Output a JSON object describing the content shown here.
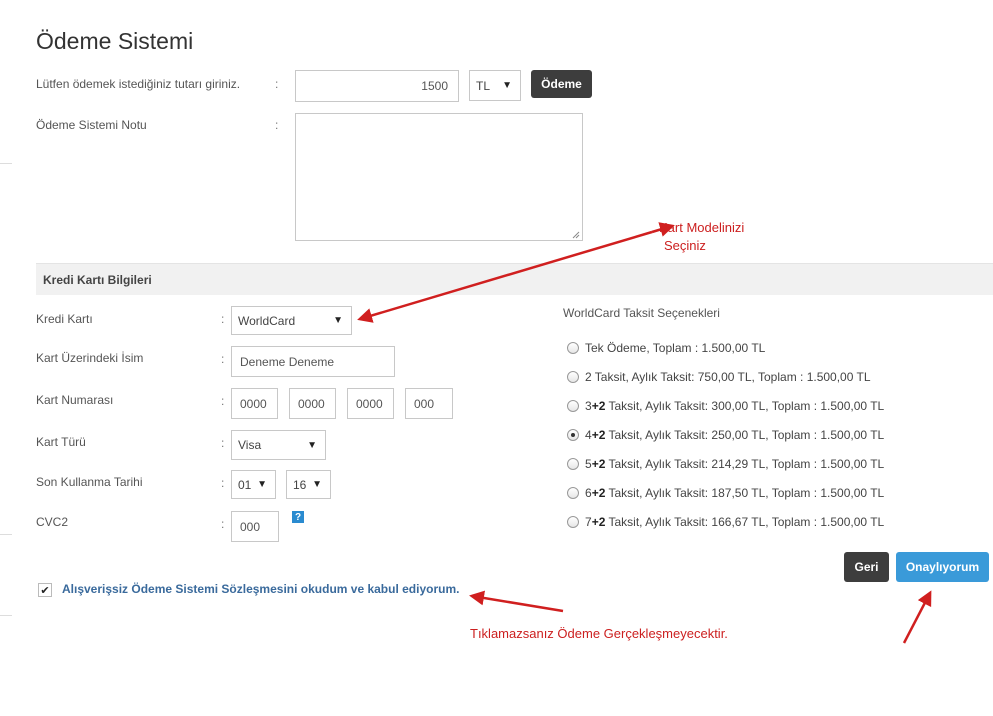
{
  "page": {
    "title": "Ödeme Sistemi"
  },
  "amount": {
    "label": "Lütfen ödemek istediğiniz tutarı giriniz.",
    "colon": ":",
    "value": "1500",
    "currency": "TL",
    "pay_button": "Ödeme"
  },
  "note": {
    "label": "Ödeme Sistemi Notu",
    "colon": ":",
    "value": ""
  },
  "card_section": {
    "title": "Kredi Kartı Bilgileri",
    "card_label": "Kredi Kartı",
    "card_value": "WorldCard",
    "name_label": "Kart Üzerindeki İsim",
    "name_value": "Deneme Deneme",
    "number_label": "Kart Numarası",
    "number_parts": [
      "0000",
      "0000",
      "0000",
      "000"
    ],
    "type_label": "Kart Türü",
    "type_value": "Visa",
    "expiry_label": "Son Kullanma Tarihi",
    "expiry_month": "01",
    "expiry_year": "16",
    "cvc_label": "CVC2",
    "cvc_value": "000",
    "help_icon": "?",
    "colon": ":"
  },
  "installments": {
    "title": "WorldCard Taksit Seçenekleri",
    "options": [
      {
        "pre": "",
        "bold": "",
        "text": "Tek Ödeme, Toplam : 1.500,00 TL",
        "selected": false
      },
      {
        "pre": "2",
        "bold": "",
        "text": " Taksit, Aylık Taksit: 750,00 TL, Toplam : 1.500,00 TL",
        "selected": false
      },
      {
        "pre": "3",
        "bold": "+2",
        "text": " Taksit, Aylık Taksit: 300,00 TL, Toplam : 1.500,00 TL",
        "selected": false
      },
      {
        "pre": "4",
        "bold": "+2",
        "text": " Taksit, Aylık Taksit: 250,00 TL, Toplam : 1.500,00 TL",
        "selected": true
      },
      {
        "pre": "5",
        "bold": "+2",
        "text": " Taksit, Aylık Taksit: 214,29 TL, Toplam : 1.500,00 TL",
        "selected": false
      },
      {
        "pre": "6",
        "bold": "+2",
        "text": " Taksit, Aylık Taksit: 187,50 TL, Toplam : 1.500,00 TL",
        "selected": false
      },
      {
        "pre": "7",
        "bold": "+2",
        "text": " Taksit, Aylık Taksit: 166,67 TL, Toplam : 1.500,00 TL",
        "selected": false
      }
    ]
  },
  "actions": {
    "back": "Geri",
    "confirm": "Onaylıyorum"
  },
  "agreement": {
    "checked": true,
    "text": "Alışverişsiz Ödeme Sistemi Sözleşmesini okudum ve kabul ediyorum."
  },
  "annotations": {
    "card_model_line1": "Kart Modelinizi",
    "card_model_line2": "Seçiniz",
    "agreement_warning": "Tıklamazsanız Ödeme Gerçekleşmeyecektir."
  },
  "colors": {
    "annotation": "#cc1f1f",
    "confirm": "#3a9ad9",
    "dark_button": "#3d3d3d",
    "link": "#3a6a9c"
  }
}
